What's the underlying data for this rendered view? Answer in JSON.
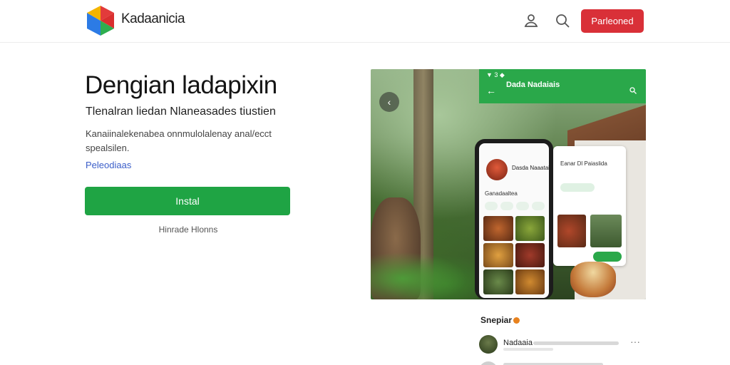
{
  "header": {
    "brand": "Kadaanicia",
    "cta_label": "Parleoned",
    "icons": [
      "user-icon",
      "search-icon"
    ]
  },
  "hero": {
    "title": "Dengian ladapixin",
    "subtitle": "Tlenalran liedan Nlaneasades tiustien",
    "description": "Kanaiinalekenabea onnmulolalenay anal/ecct spealsilen.",
    "more_link": "Peleodiaas",
    "install_label": "Instal",
    "install_note": "Hinrade Hlonns"
  },
  "media": {
    "status": "▼ 3 ◆",
    "banner_title": "Dada Nadaiais",
    "phone_name": "Dasda Naaataia",
    "phone_line": "Ganadaaltea",
    "card_name": "Eanar Dl Paiaslida"
  },
  "comments": {
    "title": "Snepiar",
    "first_name": "Nadaaia"
  },
  "colors": {
    "accent_red": "#d93038",
    "accent_green": "#1fa444",
    "link_blue": "#3b5ec9"
  }
}
